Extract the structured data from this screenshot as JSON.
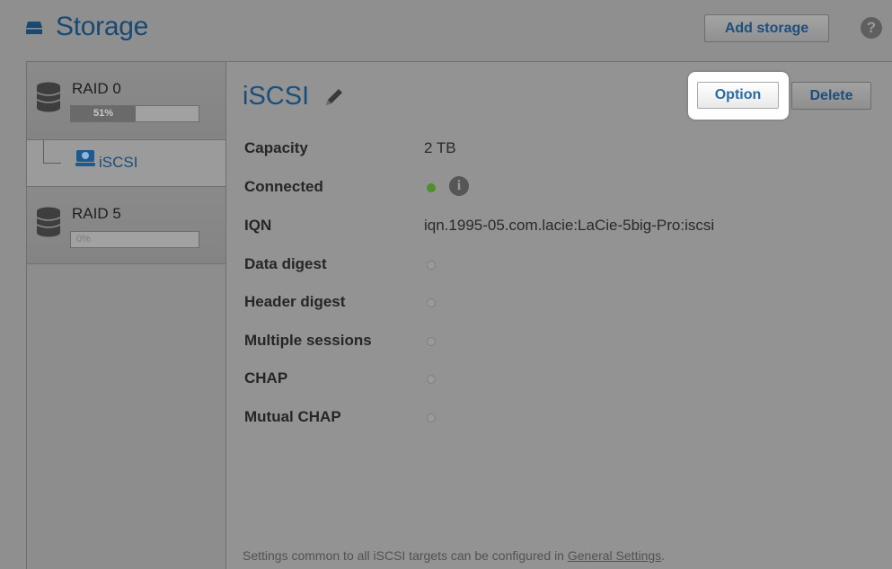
{
  "header": {
    "title": "Storage",
    "add_storage_label": "Add storage",
    "help_label": "?"
  },
  "sidebar": {
    "raids": [
      {
        "name": "RAID 0",
        "usage_pct": 51,
        "usage_label": "51%"
      },
      {
        "name": "RAID 5",
        "usage_pct": 0,
        "usage_label": "0%"
      }
    ],
    "volume_label": "iSCSI"
  },
  "content": {
    "title": "iSCSI",
    "option_label": "Option",
    "delete_label": "Delete",
    "props": {
      "capacity": {
        "label": "Capacity",
        "value": "2 TB"
      },
      "connected": {
        "label": "Connected",
        "status": "on",
        "info_icon": "info-icon"
      },
      "iqn": {
        "label": "IQN",
        "value": "iqn.1995-05.com.lacie:LaCie-5big-Pro:iscsi"
      },
      "data_digest": {
        "label": "Data digest",
        "status": "off"
      },
      "header_digest": {
        "label": "Header digest",
        "status": "off"
      },
      "multiple_sessions": {
        "label": "Multiple sessions",
        "status": "off"
      },
      "chap": {
        "label": "CHAP",
        "status": "off"
      },
      "mutual_chap": {
        "label": "Mutual CHAP",
        "status": "off"
      }
    },
    "footer": {
      "text": "Settings common to all iSCSI targets can be configured in ",
      "link": "General Settings",
      "suffix": "."
    }
  },
  "colors": {
    "accent_blue": "#1c4e7c",
    "status_on": "#4f8f2a",
    "status_off": "#9a9a9a"
  }
}
